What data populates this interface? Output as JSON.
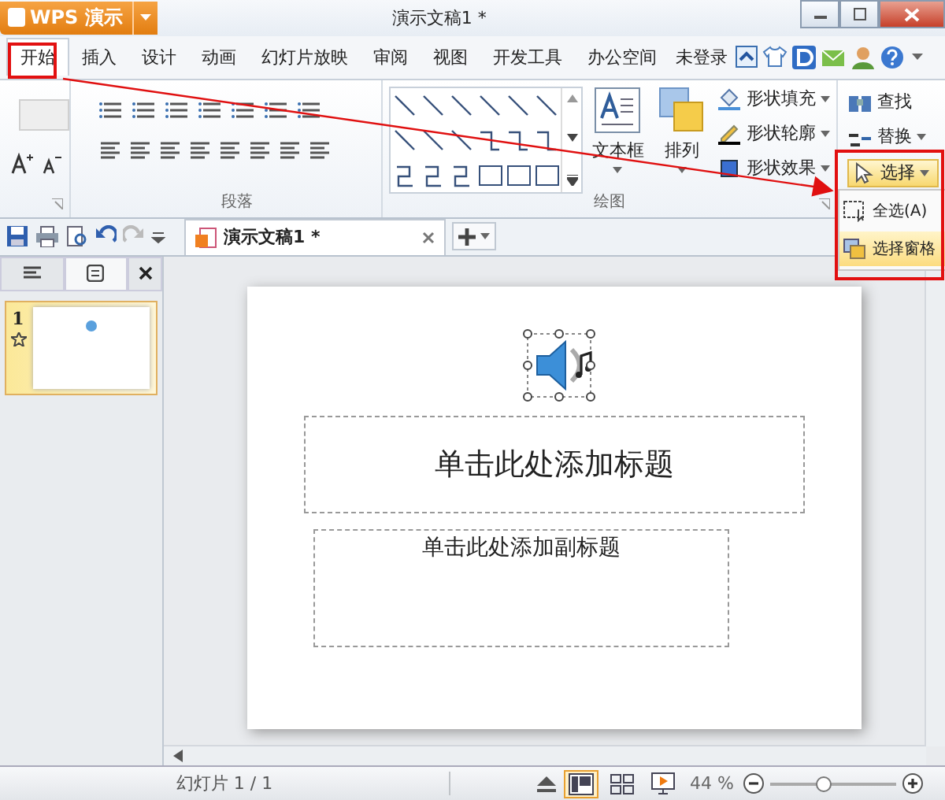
{
  "app_button": {
    "label": "WPS 演示"
  },
  "window": {
    "title": "演示文稿1 *"
  },
  "menu_tabs": [
    {
      "label": "开始",
      "selected": true
    },
    {
      "label": "插入",
      "selected": false
    },
    {
      "label": "设计",
      "selected": false
    },
    {
      "label": "动画",
      "selected": false
    },
    {
      "label": "幻灯片放映",
      "selected": false
    },
    {
      "label": "审阅",
      "selected": false
    },
    {
      "label": "视图",
      "selected": false
    },
    {
      "label": "开发工具",
      "selected": false
    },
    {
      "label": "办公空间",
      "selected": false
    }
  ],
  "account": "未登录",
  "ribbon": {
    "paragraph_group": "段落",
    "drawing_group": "绘图",
    "text_box": "文本框",
    "arrange": "排列",
    "shape_fill": "形状填充",
    "shape_outline": "形状轮廓",
    "shape_effect": "形状效果",
    "find": "查找",
    "replace": "替换",
    "select": "选择"
  },
  "select_menu": [
    {
      "label": "全选(A)",
      "selected": false
    },
    {
      "label": "选择窗格",
      "selected": true
    }
  ],
  "doc_tab": {
    "title": "演示文稿1 *"
  },
  "slide_panel": {
    "tabs": [
      {
        "kind": "outline",
        "selected": false
      },
      {
        "kind": "slides",
        "selected": true
      }
    ],
    "thumbnails": [
      {
        "number": "1",
        "selected": true
      }
    ]
  },
  "slide": {
    "title_placeholder": "单击此处添加标题",
    "subtitle_placeholder": "单击此处添加副标题"
  },
  "status_bar": {
    "slide_count": "幻灯片 1 / 1",
    "views": [
      {
        "kind": "normal",
        "selected": true
      },
      {
        "kind": "sorter",
        "selected": false
      },
      {
        "kind": "show",
        "selected": false
      }
    ],
    "zoom": "44 %",
    "zoom_slider": {
      "level": 0.42
    }
  }
}
